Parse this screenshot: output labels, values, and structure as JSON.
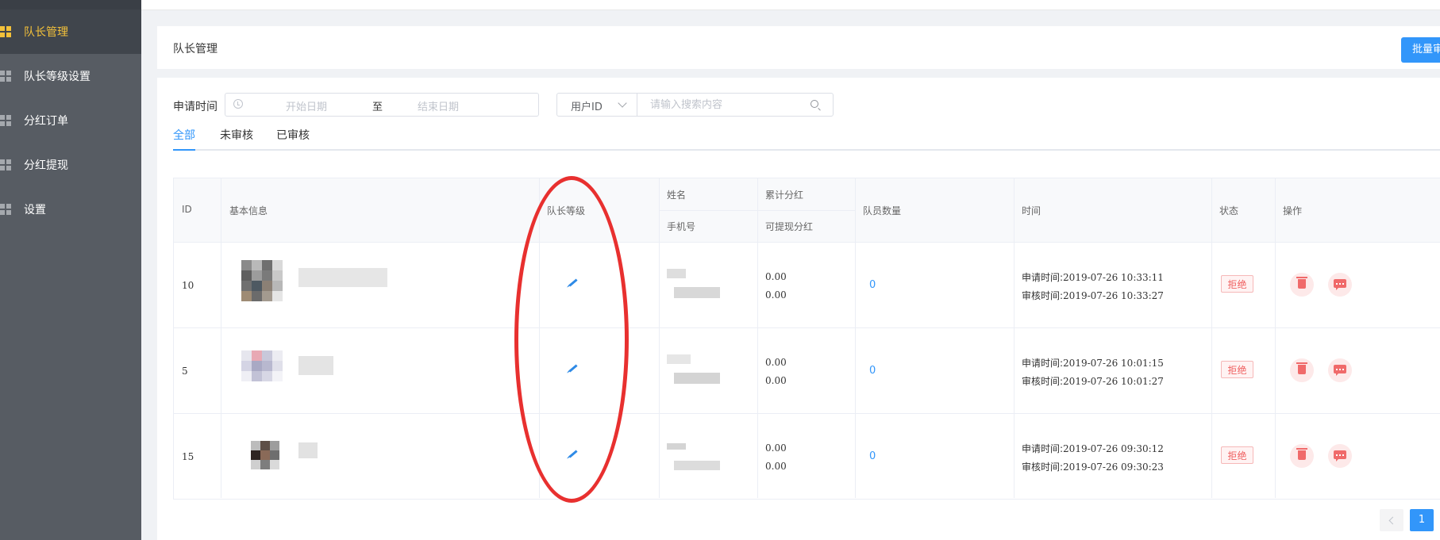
{
  "sidebar": {
    "items": [
      {
        "label": "队长管理",
        "active": true
      },
      {
        "label": "队长等级设置"
      },
      {
        "label": "分红订单"
      },
      {
        "label": "分红提现"
      },
      {
        "label": "设置"
      }
    ]
  },
  "header": {
    "title": "队长管理",
    "batch_button": "批量审核"
  },
  "filter": {
    "label": "申请时间",
    "start_placeholder": "开始日期",
    "separator": "至",
    "end_placeholder": "结束日期",
    "search_field": "用户ID",
    "search_placeholder": "请输入搜索内容"
  },
  "tabs": [
    "全部",
    "未审核",
    "已审核"
  ],
  "table": {
    "headers": {
      "id": "ID",
      "basic_info": "基本信息",
      "level": "队长等级",
      "name": "姓名",
      "phone": "手机号",
      "total_dividend": "累计分红",
      "withdrawable": "可提现分红",
      "member_count": "队员数量",
      "time": "时间",
      "status": "状态",
      "actions": "操作"
    },
    "apply_label": "申请时间:",
    "review_label": "审核时间:",
    "rows": [
      {
        "id": "10",
        "total": "0.00",
        "withdrawable": "0.00",
        "members": "0",
        "apply_time": "2019-07-26 10:33:11",
        "review_time": "2019-07-26 10:33:27",
        "status": "拒绝"
      },
      {
        "id": "5",
        "total": "0.00",
        "withdrawable": "0.00",
        "members": "0",
        "apply_time": "2019-07-26 10:01:15",
        "review_time": "2019-07-26 10:01:27",
        "status": "拒绝"
      },
      {
        "id": "15",
        "total": "0.00",
        "withdrawable": "0.00",
        "members": "0",
        "apply_time": "2019-07-26 09:30:12",
        "review_time": "2019-07-26 09:30:23",
        "status": "拒绝"
      }
    ]
  },
  "pagination": {
    "current": "1"
  },
  "colors": {
    "accent": "#3296fa",
    "danger": "#ef5f5f",
    "annotation": "#e8302f",
    "sidebar_active": "#f3c13a"
  }
}
